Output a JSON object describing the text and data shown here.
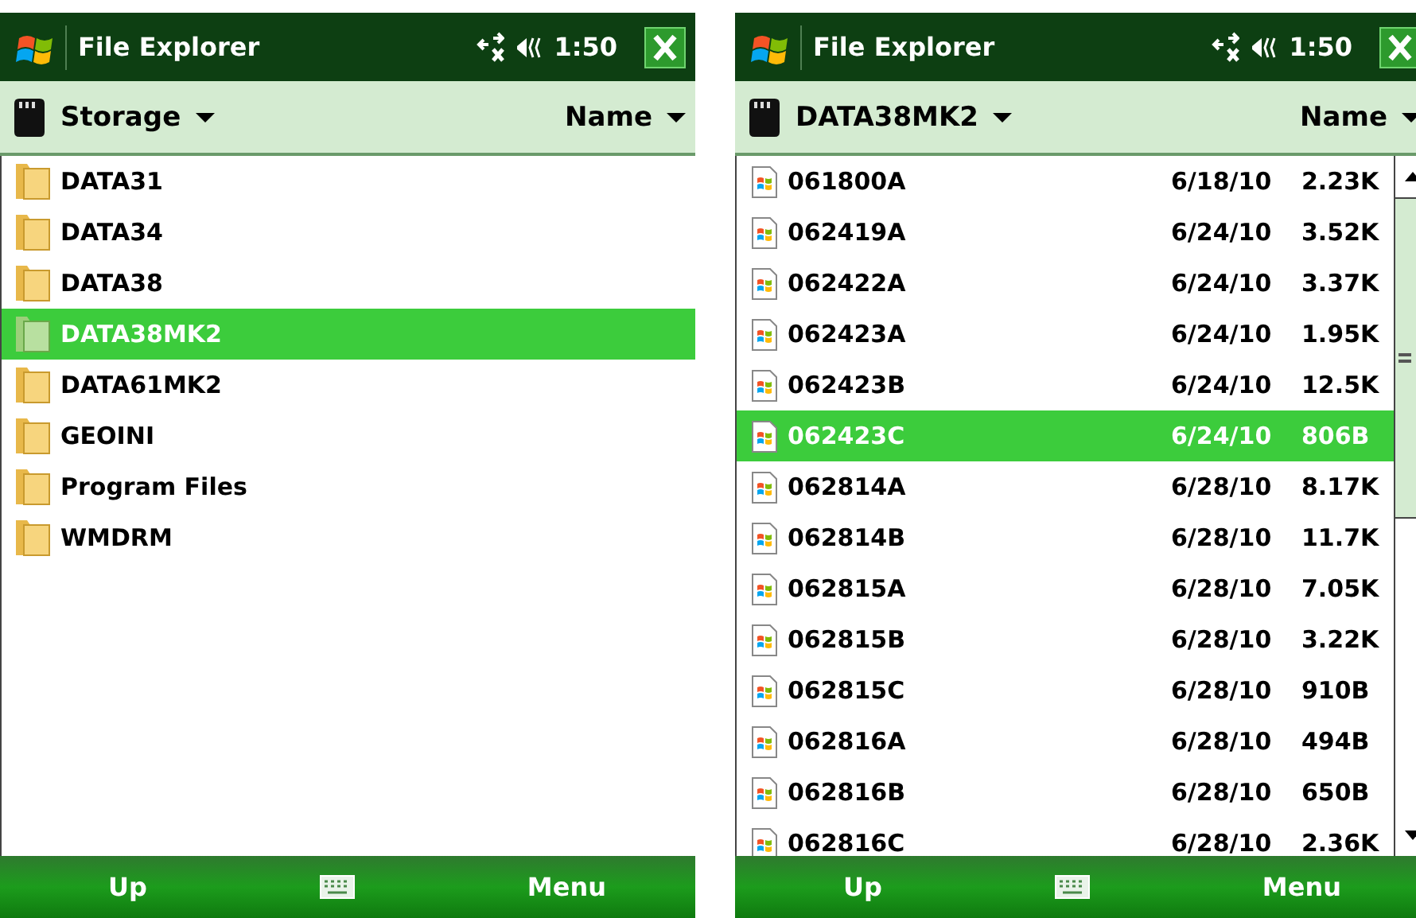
{
  "screens": [
    {
      "title": "File Explorer",
      "time": "1:50",
      "location": "Storage",
      "sort": "Name",
      "items": [
        {
          "kind": "folder",
          "name": "DATA31",
          "selected": false
        },
        {
          "kind": "folder",
          "name": "DATA34",
          "selected": false
        },
        {
          "kind": "folder",
          "name": "DATA38",
          "selected": false
        },
        {
          "kind": "folder",
          "name": "DATA38MK2",
          "selected": true
        },
        {
          "kind": "folder",
          "name": "DATA61MK2",
          "selected": false
        },
        {
          "kind": "folder",
          "name": "GEOINI",
          "selected": false
        },
        {
          "kind": "folder",
          "name": "Program Files",
          "selected": false
        },
        {
          "kind": "folder",
          "name": "WMDRM",
          "selected": false
        }
      ],
      "softkeys": {
        "left": "Up",
        "right": "Menu"
      }
    },
    {
      "title": "File Explorer",
      "time": "1:50",
      "location": "DATA38MK2",
      "sort": "Name",
      "scrollbar": true,
      "items": [
        {
          "kind": "file",
          "name": "061800A",
          "date": "6/18/10",
          "size": "2.23K",
          "selected": false
        },
        {
          "kind": "file",
          "name": "062419A",
          "date": "6/24/10",
          "size": "3.52K",
          "selected": false
        },
        {
          "kind": "file",
          "name": "062422A",
          "date": "6/24/10",
          "size": "3.37K",
          "selected": false
        },
        {
          "kind": "file",
          "name": "062423A",
          "date": "6/24/10",
          "size": "1.95K",
          "selected": false
        },
        {
          "kind": "file",
          "name": "062423B",
          "date": "6/24/10",
          "size": "12.5K",
          "selected": false
        },
        {
          "kind": "file",
          "name": "062423C",
          "date": "6/24/10",
          "size": "806B",
          "selected": true
        },
        {
          "kind": "file",
          "name": "062814A",
          "date": "6/28/10",
          "size": "8.17K",
          "selected": false
        },
        {
          "kind": "file",
          "name": "062814B",
          "date": "6/28/10",
          "size": "11.7K",
          "selected": false
        },
        {
          "kind": "file",
          "name": "062815A",
          "date": "6/28/10",
          "size": "7.05K",
          "selected": false
        },
        {
          "kind": "file",
          "name": "062815B",
          "date": "6/28/10",
          "size": "3.22K",
          "selected": false
        },
        {
          "kind": "file",
          "name": "062815C",
          "date": "6/28/10",
          "size": "910B",
          "selected": false
        },
        {
          "kind": "file",
          "name": "062816A",
          "date": "6/28/10",
          "size": "494B",
          "selected": false
        },
        {
          "kind": "file",
          "name": "062816B",
          "date": "6/28/10",
          "size": "650B",
          "selected": false
        },
        {
          "kind": "file",
          "name": "062816C",
          "date": "6/28/10",
          "size": "2.36K",
          "selected": false
        }
      ],
      "softkeys": {
        "left": "Up",
        "right": "Menu"
      }
    }
  ]
}
